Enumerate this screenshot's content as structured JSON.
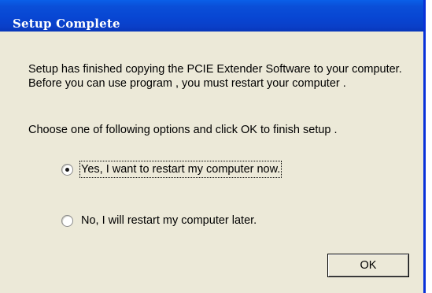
{
  "window": {
    "title": "Setup Complete"
  },
  "body": {
    "message": "Setup has finished copying the PCIE Extender Software to your computer. Before you can use program , you must restart your computer .",
    "instruction": "Choose one of following options and click OK to finish setup ."
  },
  "options": [
    {
      "label": "Yes, I want to restart my computer now.",
      "selected": true
    },
    {
      "label": "No, I will restart my computer later.",
      "selected": false
    }
  ],
  "buttons": {
    "ok_label": "OK"
  },
  "colors": {
    "titlebar": "#0846d3",
    "dialog_bg": "#ece9d8",
    "title_text": "#ffffff"
  }
}
